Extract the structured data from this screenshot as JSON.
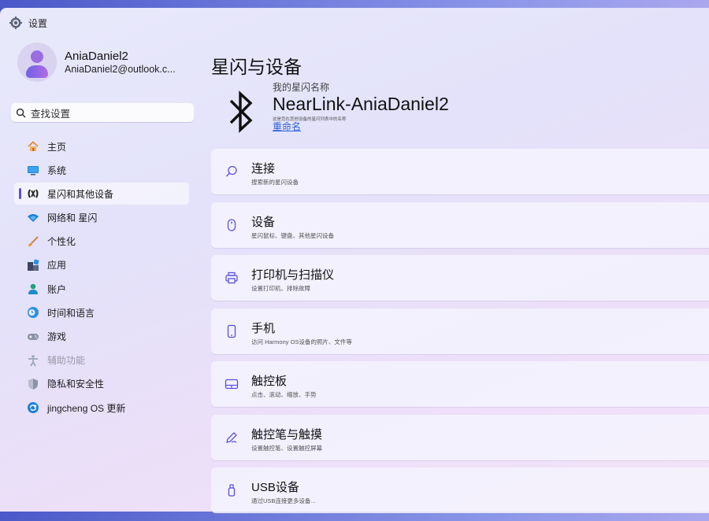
{
  "window": {
    "title": "设置"
  },
  "profile": {
    "name": "AniaDaniel2",
    "email": "AniaDaniel2@outlook.c..."
  },
  "search": {
    "placeholder": "查找设置"
  },
  "sidebar": {
    "items": [
      {
        "label": "主页",
        "icon": "home-icon"
      },
      {
        "label": "系统",
        "icon": "display-icon"
      },
      {
        "label": "星闪和其他设备",
        "icon": "nearlink-icon",
        "active": true
      },
      {
        "label": "网络和 星闪",
        "icon": "wifi-icon"
      },
      {
        "label": "个性化",
        "icon": "brush-icon"
      },
      {
        "label": "应用",
        "icon": "apps-icon"
      },
      {
        "label": "账户",
        "icon": "account-icon"
      },
      {
        "label": "时间和语言",
        "icon": "globe-clock-icon"
      },
      {
        "label": "游戏",
        "icon": "gamepad-icon"
      },
      {
        "label": "辅助功能",
        "icon": "accessibility-icon",
        "disabled": true
      },
      {
        "label": "隐私和安全性",
        "icon": "shield-icon"
      },
      {
        "label": "jingcheng OS 更新",
        "icon": "update-icon"
      }
    ]
  },
  "main": {
    "title": "星闪与设备",
    "device_label": "我的星闪名称",
    "device_name": "NearLink-AniaDaniel2",
    "device_desc": "这是您在其他设备的星闪列表中的名称",
    "rename": "重命名"
  },
  "cards": [
    {
      "title": "连接",
      "subtitle": "搜索新的星闪设备",
      "icon": "search-icon"
    },
    {
      "title": "设备",
      "subtitle": "星闪鼠标、键盘、其他星闪设备",
      "icon": "mouse-icon"
    },
    {
      "title": "打印机与扫描仪",
      "subtitle": "设置打印机、排除故障",
      "icon": "printer-icon"
    },
    {
      "title": "手机",
      "subtitle": "访问 Harmony OS设备的照片、文件等",
      "icon": "phone-icon"
    },
    {
      "title": "触控板",
      "subtitle": "点击、滚动、缩放、手势",
      "icon": "touchpad-icon"
    },
    {
      "title": "触控笔与触摸",
      "subtitle": "设置触控笔、设置触控屏幕",
      "icon": "pen-icon"
    },
    {
      "title": "USB设备",
      "subtitle": "通过USB连接更多设备...",
      "icon": "usb-icon"
    }
  ],
  "colors": {
    "accent": "#5b4fe0",
    "link": "#2b5fd9"
  }
}
